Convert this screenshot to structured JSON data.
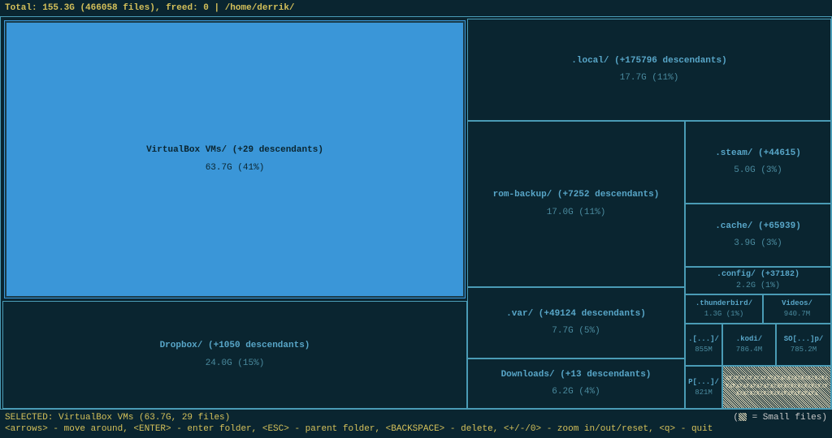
{
  "header": {
    "total_label": "Total:",
    "total_size": "155.3G",
    "total_files": "(466058 files)",
    "freed_label": "freed:",
    "freed_value": "0",
    "path": "/home/derrik/"
  },
  "cells": {
    "virtualbox": {
      "title": "VirtualBox VMs/ (+29 descendants)",
      "size": "63.7G (41%)"
    },
    "dropbox": {
      "title": "Dropbox/ (+1050 descendants)",
      "size": "24.0G (15%)"
    },
    "local": {
      "title": ".local/ (+175796 descendants)",
      "size": "17.7G (11%)"
    },
    "rombackup": {
      "title": "rom-backup/ (+7252 descendants)",
      "size": "17.0G (11%)"
    },
    "var": {
      "title": ".var/ (+49124 descendants)",
      "size": "7.7G (5%)"
    },
    "downloads": {
      "title": "Downloads/ (+13 descendants)",
      "size": "6.2G (4%)"
    },
    "steam": {
      "title": ".steam/ (+44615)",
      "size": "5.0G (3%)"
    },
    "cache": {
      "title": ".cache/ (+65939)",
      "size": "3.9G (3%)"
    },
    "config": {
      "title": ".config/ (+37182)",
      "size": "2.2G (1%)"
    },
    "thunderbird": {
      "title": ".thunderbird/",
      "size": "1.3G (1%)"
    },
    "videos": {
      "title": "Videos/",
      "size": "940.7M"
    },
    "dots": {
      "title": ".[...]/",
      "size": "855M"
    },
    "kodi": {
      "title": ".kodi/",
      "size": "786.4M"
    },
    "so": {
      "title": "SO[...]p/",
      "size": "785.2M"
    },
    "p": {
      "title": "P[...]/",
      "size": "821M"
    },
    "smallfiles": {
      "text": "XXXXXXXXXXXXXXXXXXXXXXXXXXXXXXXXXXXXXXXXXXXXXXXXXXXXXXXXXXXXXXXXXXXXXXXXXXXXXXXXXXXX"
    }
  },
  "footer": {
    "selected": "SELECTED: VirtualBox VMs (63.7G, 29 files)",
    "help": "<arrows> - move around, <ENTER> - enter folder, <ESC> - parent folder, <BACKSPACE> - delete, <+/-/0> - zoom in/out/reset, <q> - quit",
    "smallfiles_legend": " = Small files)"
  }
}
